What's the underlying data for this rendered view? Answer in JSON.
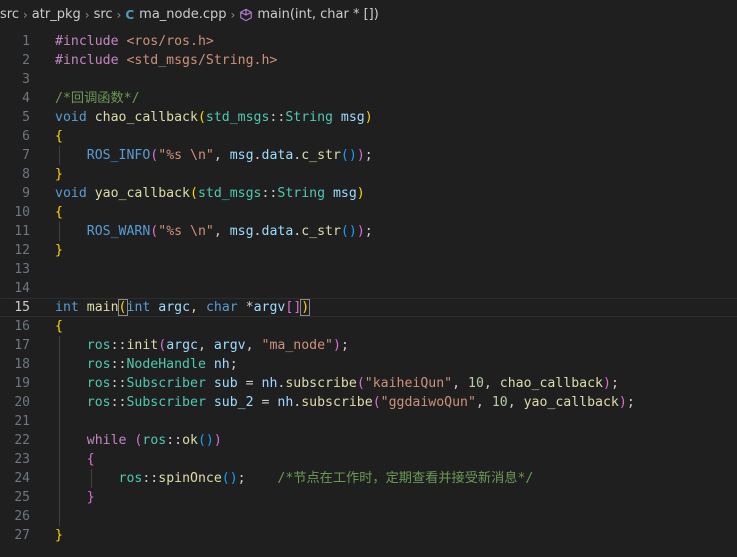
{
  "breadcrumb": [
    {
      "label": "src",
      "kind": "folder"
    },
    {
      "label": "atr_pkg",
      "kind": "folder"
    },
    {
      "label": "src",
      "kind": "folder"
    },
    {
      "label": "ma_node.cpp",
      "kind": "file",
      "icon": "C"
    },
    {
      "label": "main(int, char * [])",
      "kind": "symbol"
    }
  ],
  "active_line": 15,
  "colors": {
    "background": "#1f1f1f",
    "keyword": "#569cd6",
    "control": "#c586c0",
    "type": "#4ec9b0",
    "function": "#dcdcaa",
    "macro": "#569cd6",
    "string": "#ce9178",
    "number": "#b5cea8",
    "comment": "#6a9955",
    "variable": "#9cdcfe",
    "plain": "#cccccc",
    "bracket1": "#ffd700",
    "bracket2": "#da70d6",
    "bracket3": "#179fff"
  },
  "lines": [
    {
      "n": "1",
      "tokens": [
        [
          "#include",
          "control"
        ],
        [
          " ",
          "plain"
        ],
        [
          "<ros/ros.h>",
          "string"
        ]
      ]
    },
    {
      "n": "2",
      "tokens": [
        [
          "#include",
          "control"
        ],
        [
          " ",
          "plain"
        ],
        [
          "<std_msgs/String.h>",
          "string"
        ]
      ]
    },
    {
      "n": "3",
      "tokens": []
    },
    {
      "n": "4",
      "tokens": [
        [
          "/*回调函数*/",
          "comment"
        ]
      ]
    },
    {
      "n": "5",
      "tokens": [
        [
          "void",
          "keyword"
        ],
        [
          " ",
          "plain"
        ],
        [
          "chao_callback",
          "function"
        ],
        [
          "(",
          "bracket1"
        ],
        [
          "std_msgs",
          "type"
        ],
        [
          "::",
          "plain"
        ],
        [
          "String",
          "type"
        ],
        [
          " ",
          "plain"
        ],
        [
          "msg",
          "variable"
        ],
        [
          ")",
          "bracket1"
        ]
      ]
    },
    {
      "n": "6",
      "tokens": [
        [
          "{",
          "bracket1"
        ]
      ]
    },
    {
      "n": "7",
      "tokens": [
        [
          "    ",
          "plain"
        ],
        [
          "ROS_INFO",
          "macro"
        ],
        [
          "(",
          "bracket2"
        ],
        [
          "\"%s \\n\"",
          "string"
        ],
        [
          ", ",
          "plain"
        ],
        [
          "msg",
          "variable"
        ],
        [
          ".",
          "plain"
        ],
        [
          "data",
          "variable"
        ],
        [
          ".",
          "plain"
        ],
        [
          "c_str",
          "function"
        ],
        [
          "()",
          "bracket3"
        ],
        [
          ")",
          "bracket2"
        ],
        [
          ";",
          "plain"
        ]
      ]
    },
    {
      "n": "8",
      "tokens": [
        [
          "}",
          "bracket1"
        ]
      ]
    },
    {
      "n": "9",
      "tokens": [
        [
          "void",
          "keyword"
        ],
        [
          " ",
          "plain"
        ],
        [
          "yao_callback",
          "function"
        ],
        [
          "(",
          "bracket1"
        ],
        [
          "std_msgs",
          "type"
        ],
        [
          "::",
          "plain"
        ],
        [
          "String",
          "type"
        ],
        [
          " ",
          "plain"
        ],
        [
          "msg",
          "variable"
        ],
        [
          ")",
          "bracket1"
        ]
      ]
    },
    {
      "n": "10",
      "tokens": [
        [
          "{",
          "bracket1"
        ]
      ]
    },
    {
      "n": "11",
      "tokens": [
        [
          "    ",
          "plain"
        ],
        [
          "ROS_WARN",
          "macro"
        ],
        [
          "(",
          "bracket2"
        ],
        [
          "\"%s \\n\"",
          "string"
        ],
        [
          ", ",
          "plain"
        ],
        [
          "msg",
          "variable"
        ],
        [
          ".",
          "plain"
        ],
        [
          "data",
          "variable"
        ],
        [
          ".",
          "plain"
        ],
        [
          "c_str",
          "function"
        ],
        [
          "()",
          "bracket3"
        ],
        [
          ")",
          "bracket2"
        ],
        [
          ";",
          "plain"
        ]
      ]
    },
    {
      "n": "12",
      "tokens": [
        [
          "}",
          "bracket1"
        ]
      ]
    },
    {
      "n": "13",
      "tokens": []
    },
    {
      "n": "14",
      "tokens": []
    },
    {
      "n": "15",
      "tokens": [
        [
          "int",
          "keyword"
        ],
        [
          " ",
          "plain"
        ],
        [
          "main",
          "function"
        ],
        [
          "(",
          "bracket1-box"
        ],
        [
          "int",
          "keyword"
        ],
        [
          " ",
          "plain"
        ],
        [
          "argc",
          "variable"
        ],
        [
          ", ",
          "plain"
        ],
        [
          "char",
          "keyword"
        ],
        [
          " ",
          "plain"
        ],
        [
          "*",
          "plain"
        ],
        [
          "argv",
          "variable"
        ],
        [
          "[]",
          "bracket2"
        ],
        [
          ")",
          "bracket1-box"
        ]
      ]
    },
    {
      "n": "16",
      "tokens": [
        [
          "{",
          "bracket1"
        ]
      ]
    },
    {
      "n": "17",
      "tokens": [
        [
          "    ",
          "plain"
        ],
        [
          "ros",
          "type"
        ],
        [
          "::",
          "plain"
        ],
        [
          "init",
          "function"
        ],
        [
          "(",
          "bracket2"
        ],
        [
          "argc",
          "variable"
        ],
        [
          ", ",
          "plain"
        ],
        [
          "argv",
          "variable"
        ],
        [
          ", ",
          "plain"
        ],
        [
          "\"ma_node\"",
          "string"
        ],
        [
          ")",
          "bracket2"
        ],
        [
          ";",
          "plain"
        ]
      ]
    },
    {
      "n": "18",
      "tokens": [
        [
          "    ",
          "plain"
        ],
        [
          "ros",
          "type"
        ],
        [
          "::",
          "plain"
        ],
        [
          "NodeHandle",
          "type"
        ],
        [
          " ",
          "plain"
        ],
        [
          "nh",
          "variable"
        ],
        [
          ";",
          "plain"
        ]
      ]
    },
    {
      "n": "19",
      "tokens": [
        [
          "    ",
          "plain"
        ],
        [
          "ros",
          "type"
        ],
        [
          "::",
          "plain"
        ],
        [
          "Subscriber",
          "type"
        ],
        [
          " ",
          "plain"
        ],
        [
          "sub",
          "variable"
        ],
        [
          " = ",
          "plain"
        ],
        [
          "nh",
          "variable"
        ],
        [
          ".",
          "plain"
        ],
        [
          "subscribe",
          "function"
        ],
        [
          "(",
          "bracket2"
        ],
        [
          "\"kaiheiQun\"",
          "string"
        ],
        [
          ", ",
          "plain"
        ],
        [
          "10",
          "number"
        ],
        [
          ", ",
          "plain"
        ],
        [
          "chao_callback",
          "function"
        ],
        [
          ")",
          "bracket2"
        ],
        [
          ";",
          "plain"
        ]
      ]
    },
    {
      "n": "20",
      "tokens": [
        [
          "    ",
          "plain"
        ],
        [
          "ros",
          "type"
        ],
        [
          "::",
          "plain"
        ],
        [
          "Subscriber",
          "type"
        ],
        [
          " ",
          "plain"
        ],
        [
          "sub_2",
          "variable"
        ],
        [
          " = ",
          "plain"
        ],
        [
          "nh",
          "variable"
        ],
        [
          ".",
          "plain"
        ],
        [
          "subscribe",
          "function"
        ],
        [
          "(",
          "bracket2"
        ],
        [
          "\"ggdaiwoQun\"",
          "string"
        ],
        [
          ", ",
          "plain"
        ],
        [
          "10",
          "number"
        ],
        [
          ", ",
          "plain"
        ],
        [
          "yao_callback",
          "function"
        ],
        [
          ")",
          "bracket2"
        ],
        [
          ";",
          "plain"
        ]
      ]
    },
    {
      "n": "21",
      "tokens": []
    },
    {
      "n": "22",
      "tokens": [
        [
          "    ",
          "plain"
        ],
        [
          "while",
          "control"
        ],
        [
          " ",
          "plain"
        ],
        [
          "(",
          "bracket2"
        ],
        [
          "ros",
          "type"
        ],
        [
          "::",
          "plain"
        ],
        [
          "ok",
          "function"
        ],
        [
          "()",
          "bracket3"
        ],
        [
          ")",
          "bracket2"
        ]
      ]
    },
    {
      "n": "23",
      "tokens": [
        [
          "    ",
          "plain"
        ],
        [
          "{",
          "bracket2"
        ]
      ]
    },
    {
      "n": "24",
      "tokens": [
        [
          "        ",
          "plain"
        ],
        [
          "ros",
          "type"
        ],
        [
          "::",
          "plain"
        ],
        [
          "spinOnce",
          "function"
        ],
        [
          "()",
          "bracket3"
        ],
        [
          ";",
          "plain"
        ],
        [
          "    ",
          "plain"
        ],
        [
          "/*节点在工作时，定期查看并接受新消息*/",
          "comment"
        ]
      ]
    },
    {
      "n": "25",
      "tokens": [
        [
          "    ",
          "plain"
        ],
        [
          "}",
          "bracket2"
        ]
      ]
    },
    {
      "n": "26",
      "tokens": []
    },
    {
      "n": "27",
      "tokens": [
        [
          "}",
          "bracket1"
        ]
      ]
    }
  ]
}
